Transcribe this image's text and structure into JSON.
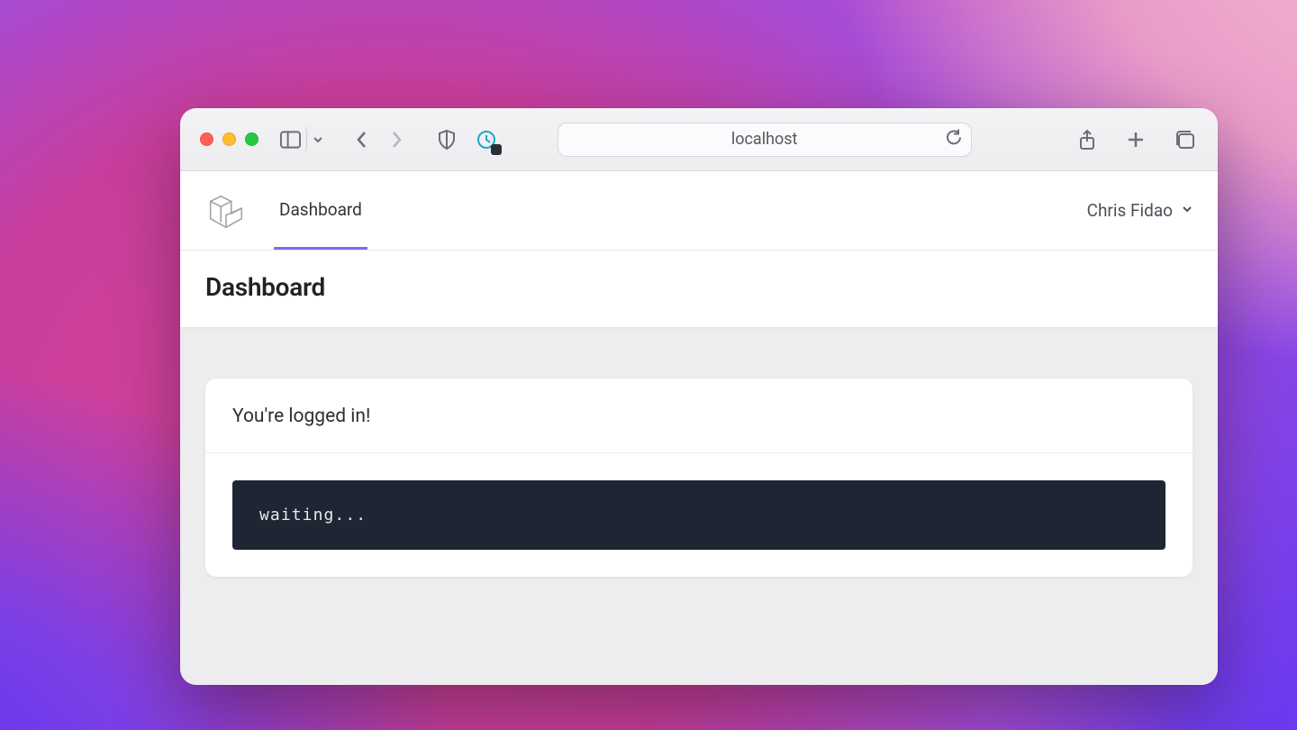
{
  "browser": {
    "address": "localhost"
  },
  "nav": {
    "tab_label": "Dashboard",
    "user_name": "Chris Fidao"
  },
  "page": {
    "title": "Dashboard",
    "welcome": "You're logged in!",
    "terminal": "waiting..."
  }
}
